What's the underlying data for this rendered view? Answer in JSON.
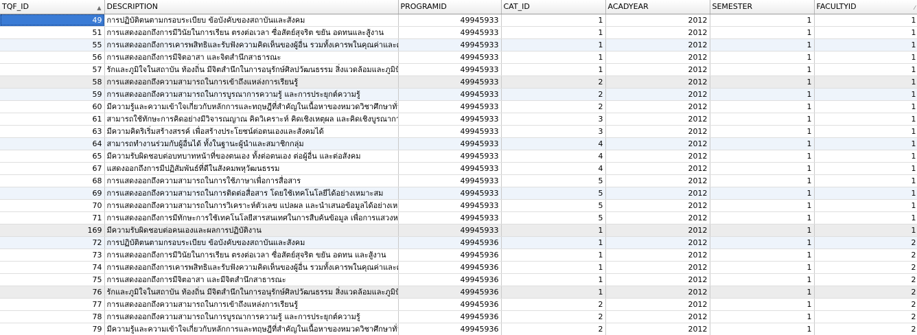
{
  "columns": [
    {
      "key": "tqf_id",
      "label": "TQF_ID",
      "sort": "▲"
    },
    {
      "key": "description",
      "label": "DESCRIPTION",
      "sort": ""
    },
    {
      "key": "programid",
      "label": "PROGRAMID",
      "sort": ""
    },
    {
      "key": "cat_id",
      "label": "CAT_ID",
      "sort": ""
    },
    {
      "key": "acadyear",
      "label": "ACADYEAR",
      "sort": ""
    },
    {
      "key": "semester",
      "label": "SEMESTER",
      "sort": ""
    },
    {
      "key": "facultyid",
      "label": "FACULTYID",
      "sort": "⁄"
    }
  ],
  "rows": [
    {
      "tqf_id": "49",
      "description": "การปฏิบัติตนตามกรอบระเบียบ ข้อบังคับของสถาบันและสังคม",
      "programid": "49945933",
      "cat_id": "1",
      "acadyear": "2012",
      "semester": "1",
      "facultyid": "1"
    },
    {
      "tqf_id": "51",
      "description": "การแสดงออกถึงการมีวินัยในการเรียน ตรงต่อเวลา ซื่อสัตย์สุจริต ขยัน อดทนและสู้งาน",
      "programid": "49945933",
      "cat_id": "1",
      "acadyear": "2012",
      "semester": "1",
      "facultyid": "1"
    },
    {
      "tqf_id": "55",
      "description": "การแสดงออกถึงการเคารพสิทธิและรับฟังความคิดเห็นของผู้อื่น รวมทั้งเคารพในคุณค่าและศักดิ์ศรี",
      "programid": "49945933",
      "cat_id": "1",
      "acadyear": "2012",
      "semester": "1",
      "facultyid": "1"
    },
    {
      "tqf_id": "56",
      "description": "การแสดงออกถึงการมีจิตอาสา และจิตสำนึกสาธารณะ",
      "programid": "49945933",
      "cat_id": "1",
      "acadyear": "2012",
      "semester": "1",
      "facultyid": "1"
    },
    {
      "tqf_id": "57",
      "description": "รักและภูมิใจในสถาบัน ท้องถิ่น มีจิตสำนึกในการอนุรักษ์ศิลปวัฒนธรรม สิ่งแวดล้อมและภูมิปัญญา",
      "programid": "49945933",
      "cat_id": "1",
      "acadyear": "2012",
      "semester": "1",
      "facultyid": "1"
    },
    {
      "tqf_id": "58",
      "description": "การแสดงออกถึงความสามารถในการเข้าถึงแหล่งการเรียนรู้",
      "programid": "49945933",
      "cat_id": "2",
      "acadyear": "2012",
      "semester": "1",
      "facultyid": "1"
    },
    {
      "tqf_id": "59",
      "description": "การแสดงออกถึงความสามารถในการบูรณาการความรู้ และการประยุกต์ความรู้",
      "programid": "49945933",
      "cat_id": "2",
      "acadyear": "2012",
      "semester": "1",
      "facultyid": "1"
    },
    {
      "tqf_id": "60",
      "description": "มีความรู้และความเข้าใจเกี่ยวกับหลักการและทฤษฎีที่สำคัญในเนื้อหาของหมวดวิชาศึกษาทั่วไป",
      "programid": "49945933",
      "cat_id": "2",
      "acadyear": "2012",
      "semester": "1",
      "facultyid": "1"
    },
    {
      "tqf_id": "61",
      "description": "สามารถใช้ทักษะการคิดอย่างมีวิจารณญาณ คิดวิเคราะห์ คิดเชิงเหตุผล และคิดเชิงบูรณาการ ในชีวิต",
      "programid": "49945933",
      "cat_id": "3",
      "acadyear": "2012",
      "semester": "1",
      "facultyid": "1"
    },
    {
      "tqf_id": "63",
      "description": "มีความคิดริเริ่มสร้างสรรค์ เพื่อสร้างประโยชน์ต่อตนเองและสังคมได้",
      "programid": "49945933",
      "cat_id": "3",
      "acadyear": "2012",
      "semester": "1",
      "facultyid": "1"
    },
    {
      "tqf_id": "64",
      "description": "สามารถทำงานร่วมกับผู้อื่นได้ ทั้งในฐานะผู้นำและสมาชิกกลุ่ม",
      "programid": "49945933",
      "cat_id": "4",
      "acadyear": "2012",
      "semester": "1",
      "facultyid": "1"
    },
    {
      "tqf_id": "65",
      "description": "มีความรับผิดชอบต่อบทบาทหน้าที่ของตนเอง ทั้งต่อตนเอง ต่อผู้อื่น และต่อสังคม",
      "programid": "49945933",
      "cat_id": "4",
      "acadyear": "2012",
      "semester": "1",
      "facultyid": "1"
    },
    {
      "tqf_id": "67",
      "description": "แสดงออกถึงการมีปฏิสัมพันธ์ที่ดีในสังคมพหุวัฒนธรรม",
      "programid": "49945933",
      "cat_id": "4",
      "acadyear": "2012",
      "semester": "1",
      "facultyid": "1"
    },
    {
      "tqf_id": "68",
      "description": "การแสดงออกถึงความสามารถในการใช้ภาษาเพื่อการสื่อสาร",
      "programid": "49945933",
      "cat_id": "5",
      "acadyear": "2012",
      "semester": "1",
      "facultyid": "1"
    },
    {
      "tqf_id": "69",
      "description": "การแสดงออกถึงความสามารถในการติดต่อสื่อสาร โดยใช้เทคโนโลยีได้อย่างเหมาะสม",
      "programid": "49945933",
      "cat_id": "5",
      "acadyear": "2012",
      "semester": "1",
      "facultyid": "1"
    },
    {
      "tqf_id": "70",
      "description": "การแสดงออกถึงความสามารถในการวิเคราะห์ตัวเลข แปลผล และนำเสนอข้อมูลได้อย่างเหมาะสม",
      "programid": "49945933",
      "cat_id": "5",
      "acadyear": "2012",
      "semester": "1",
      "facultyid": "1"
    },
    {
      "tqf_id": "71",
      "description": "การแสดงออกถึงการมีทักษะการใช้เทคโนโลยีสารสนเทศในการสืบค้นข้อมูล เพื่อการแสวงหาความรู้",
      "programid": "49945933",
      "cat_id": "5",
      "acadyear": "2012",
      "semester": "1",
      "facultyid": "1"
    },
    {
      "tqf_id": "169",
      "description": "มีความรับผิดชอบต่อคนเองและผลการปฏิบัติงาน",
      "programid": "49945933",
      "cat_id": "1",
      "acadyear": "2012",
      "semester": "1",
      "facultyid": "1"
    },
    {
      "tqf_id": "72",
      "description": "การปฏิบัติตนตามกรอบระเบียบ ข้อบังคับของสถาบันและสังคม",
      "programid": "49945936",
      "cat_id": "1",
      "acadyear": "2012",
      "semester": "1",
      "facultyid": "2"
    },
    {
      "tqf_id": "73",
      "description": "การแสดงออกถึงการมีวินัยในการเรียน ตรงต่อเวลา ซื่อสัตย์สุจริต ขยัน อดทน และสู้งาน",
      "programid": "49945936",
      "cat_id": "1",
      "acadyear": "2012",
      "semester": "1",
      "facultyid": "2"
    },
    {
      "tqf_id": "74",
      "description": "การแสดงออกถึงการเคารพสิทธิและรับฟังความคิดเห็นของผู้อื่น รวมทั้งเคารพในคุณค่าและศักดิ์ศรี",
      "programid": "49945936",
      "cat_id": "1",
      "acadyear": "2012",
      "semester": "1",
      "facultyid": "2"
    },
    {
      "tqf_id": "75",
      "description": "การแสดงออกถึงการมีจิตอาสา และมีจิตสำนึกสาธารณะ",
      "programid": "49945936",
      "cat_id": "1",
      "acadyear": "2012",
      "semester": "1",
      "facultyid": "2"
    },
    {
      "tqf_id": "76",
      "description": "รักและภูมิใจในสถาบัน ท้องถิ่น มีจิตสำนึกในการอนุรักษ์ศิลปวัฒนธรรม สิ่งแวดล้อมและภูมิปัญญา",
      "programid": "49945936",
      "cat_id": "1",
      "acadyear": "2012",
      "semester": "1",
      "facultyid": "2"
    },
    {
      "tqf_id": "77",
      "description": "การแสดงออกถึงความสามารถในการเข้าถึงแหล่งการเรียนรู้",
      "programid": "49945936",
      "cat_id": "2",
      "acadyear": "2012",
      "semester": "1",
      "facultyid": "2"
    },
    {
      "tqf_id": "78",
      "description": "การแสดงออกถึงความสามารถในการบูรณาการความรู้ และการประยุกต์ความรู้",
      "programid": "49945936",
      "cat_id": "2",
      "acadyear": "2012",
      "semester": "1",
      "facultyid": "2"
    },
    {
      "tqf_id": "79",
      "description": "มีความรู้และความเข้าใจเกี่ยวกับหลักการและทฤษฎีที่สำคัญในเนื้อหาของหมวดวิชาศึกษาทั่วไป",
      "programid": "49945936",
      "cat_id": "2",
      "acadyear": "2012",
      "semester": "1",
      "facultyid": "2"
    }
  ]
}
